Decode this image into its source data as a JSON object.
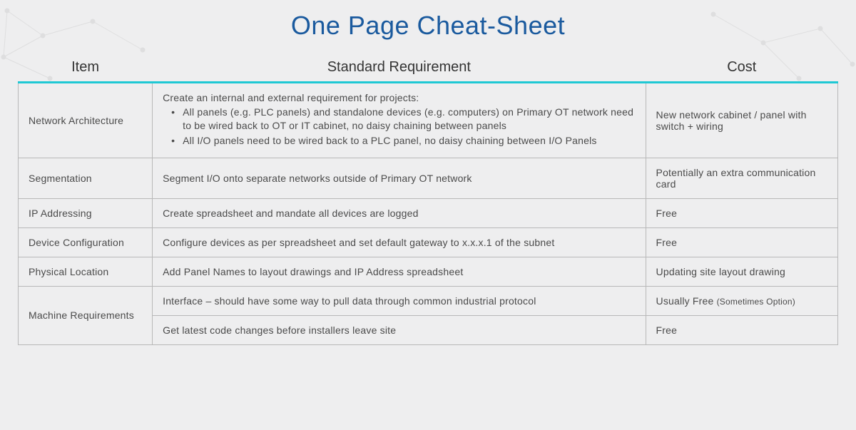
{
  "title": "One Page Cheat-Sheet",
  "columns": {
    "item": "Item",
    "requirement": "Standard Requirement",
    "cost": "Cost"
  },
  "rows": [
    {
      "item": "Network Architecture",
      "requirement_intro": "Create an internal and external requirement for projects:",
      "requirement_bullets": [
        "All panels (e.g. PLC panels) and standalone devices (e.g. computers) on Primary OT network need to be wired back to OT or IT cabinet, no daisy chaining between panels",
        "All I/O panels need to be wired back to a PLC panel, no daisy chaining between I/O Panels"
      ],
      "requirement_text": "",
      "cost": "New network cabinet / panel with switch + wiring",
      "cost_note": ""
    },
    {
      "item": "Segmentation",
      "requirement_intro": "",
      "requirement_bullets": [],
      "requirement_text": "Segment I/O onto separate networks outside of Primary OT network",
      "cost": "Potentially an extra communication card",
      "cost_note": ""
    },
    {
      "item": "IP Addressing",
      "requirement_intro": "",
      "requirement_bullets": [],
      "requirement_text": "Create spreadsheet and mandate all devices are logged",
      "cost": "Free",
      "cost_note": ""
    },
    {
      "item": "Device Configuration",
      "requirement_intro": "",
      "requirement_bullets": [],
      "requirement_text": "Configure devices as per spreadsheet and set default gateway to x.x.x.1 of the subnet",
      "cost": "Free",
      "cost_note": ""
    },
    {
      "item": "Physical Location",
      "requirement_intro": "",
      "requirement_bullets": [],
      "requirement_text": "Add Panel Names to layout drawings and IP Address spreadsheet",
      "cost": "Updating site layout drawing",
      "cost_note": ""
    },
    {
      "item": "Machine Requirements",
      "requirement_intro": "",
      "requirement_bullets": [],
      "requirement_text": "Interface – should have some way to pull data through common industrial protocol",
      "cost": "Usually Free ",
      "cost_note": "(Sometimes Option)",
      "rowspan": 2
    },
    {
      "item": "",
      "requirement_intro": "",
      "requirement_bullets": [],
      "requirement_text": "Get latest code changes before installers leave site",
      "cost": "Free",
      "cost_note": "",
      "merged": true
    }
  ]
}
